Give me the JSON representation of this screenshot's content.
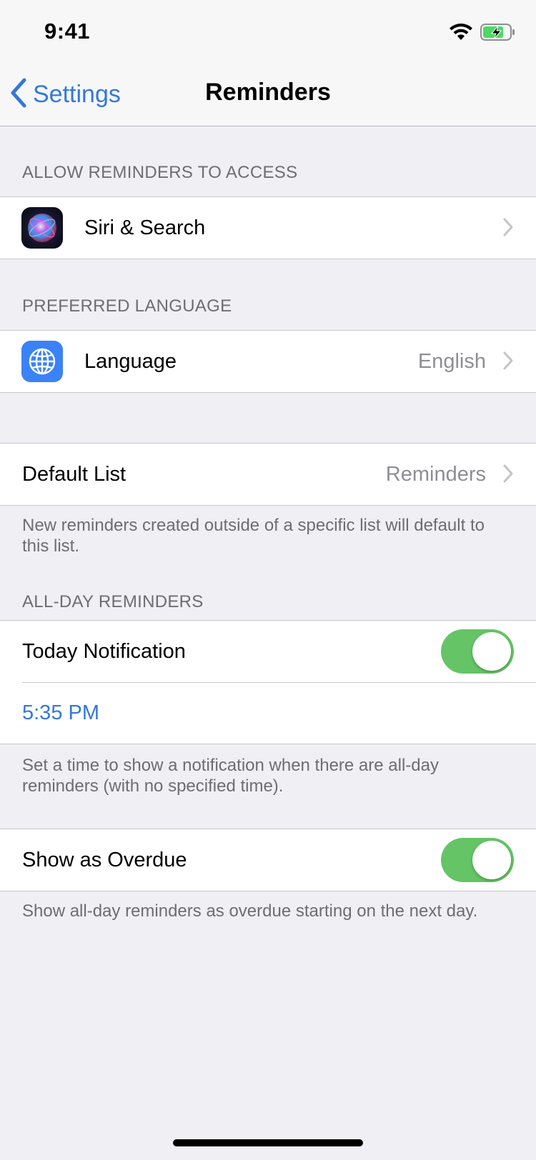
{
  "status_bar": {
    "time": "9:41",
    "wifi_icon": "wifi-icon",
    "battery_icon": "battery-charging-icon"
  },
  "nav": {
    "back_label": "Settings",
    "back_icon": "chevron-left-icon",
    "title": "Reminders"
  },
  "sections": {
    "access": {
      "header": "ALLOW REMINDERS TO ACCESS",
      "siri": {
        "label": "Siri & Search",
        "icon": "siri-icon"
      }
    },
    "language": {
      "header": "PREFERRED LANGUAGE",
      "item": {
        "label": "Language",
        "value": "English",
        "icon": "globe-icon"
      }
    },
    "default_list": {
      "label": "Default List",
      "value": "Reminders",
      "footer": "New reminders created outside of a specific list will default to this list."
    },
    "all_day": {
      "header": "ALL-DAY REMINDERS",
      "today_notification": {
        "label": "Today Notification",
        "on": true
      },
      "time": "5:35 PM",
      "footer": "Set a time to show a notification when there are all-day reminders (with no specified time)."
    },
    "overdue": {
      "label": "Show as Overdue",
      "on": true,
      "footer": "Show all-day reminders as overdue starting on the next day."
    }
  },
  "colors": {
    "accent": "#3478d8",
    "toggle_on": "#65c466",
    "background": "#efeff4",
    "secondary_text": "#6d6d72"
  }
}
